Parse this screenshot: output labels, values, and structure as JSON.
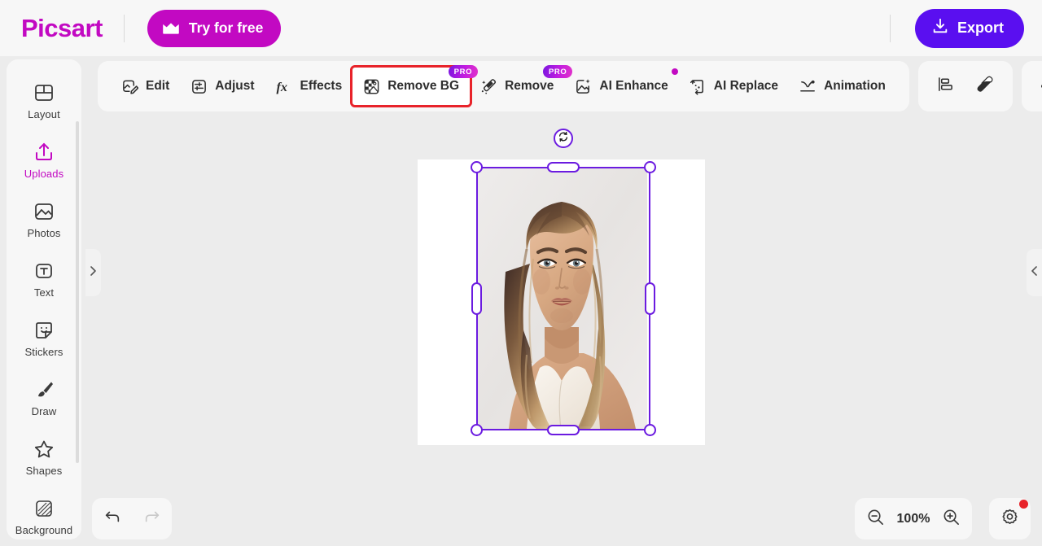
{
  "app": {
    "name": "Picsart",
    "brand_color": "#c209c2",
    "export_color": "#5a0ff0",
    "selection_color": "#6b1be0",
    "highlight_color": "#e8232a"
  },
  "header": {
    "logo_text": "Picsart",
    "try_free_label": "Try for free",
    "try_free_icon": "crown-icon",
    "export_label": "Export",
    "export_icon": "download-icon"
  },
  "sidebar": {
    "items": [
      {
        "label": "Layout",
        "icon": "layout-icon",
        "active": false
      },
      {
        "label": "Uploads",
        "icon": "upload-icon",
        "active": true
      },
      {
        "label": "Photos",
        "icon": "photo-icon",
        "active": false
      },
      {
        "label": "Text",
        "icon": "text-icon",
        "active": false
      },
      {
        "label": "Stickers",
        "icon": "sticker-icon",
        "active": false
      },
      {
        "label": "Draw",
        "icon": "brush-icon",
        "active": false
      },
      {
        "label": "Shapes",
        "icon": "star-icon",
        "active": false
      },
      {
        "label": "Background",
        "icon": "background-icon",
        "active": false
      }
    ]
  },
  "panel_toggles": {
    "left_icon": "chevron-right-icon",
    "right_icon": "chevron-left-icon"
  },
  "toolbar": {
    "tools": [
      {
        "label": "Edit",
        "icon": "edit-icon",
        "badge": null,
        "highlighted": false
      },
      {
        "label": "Adjust",
        "icon": "adjust-icon",
        "badge": null,
        "highlighted": false
      },
      {
        "label": "Effects",
        "icon": "effects-fx-icon",
        "badge": null,
        "highlighted": false
      },
      {
        "label": "Remove BG",
        "icon": "remove-bg-icon",
        "badge": "PRO",
        "highlighted": true
      },
      {
        "label": "Remove",
        "icon": "eraser-wand-icon",
        "badge": "PRO",
        "highlighted": false
      },
      {
        "label": "AI Enhance",
        "icon": "ai-enhance-icon",
        "badge": "dot",
        "highlighted": false
      },
      {
        "label": "AI Replace",
        "icon": "ai-replace-icon",
        "badge": null,
        "highlighted": false
      },
      {
        "label": "Animation",
        "icon": "animation-icon",
        "badge": null,
        "highlighted": false
      }
    ],
    "secondary_icons": [
      "align-icon",
      "eraser-icon"
    ],
    "more_icon": "more-horizontal-icon"
  },
  "canvas": {
    "artboard_background": "#ffffff",
    "selection": {
      "rotate_icon": "rotate-icon",
      "handles": [
        "top-left",
        "top-right",
        "bottom-left",
        "bottom-right",
        "top-middle",
        "bottom-middle",
        "left-middle",
        "right-middle"
      ]
    },
    "image_alt": "portrait-photo"
  },
  "bottombar": {
    "undo_icon": "undo-icon",
    "redo_icon": "redo-icon",
    "zoom_out_icon": "zoom-out-icon",
    "zoom_in_icon": "zoom-in-icon",
    "zoom_level": "100%",
    "settings_icon": "gear-icon",
    "settings_has_notification": true
  }
}
